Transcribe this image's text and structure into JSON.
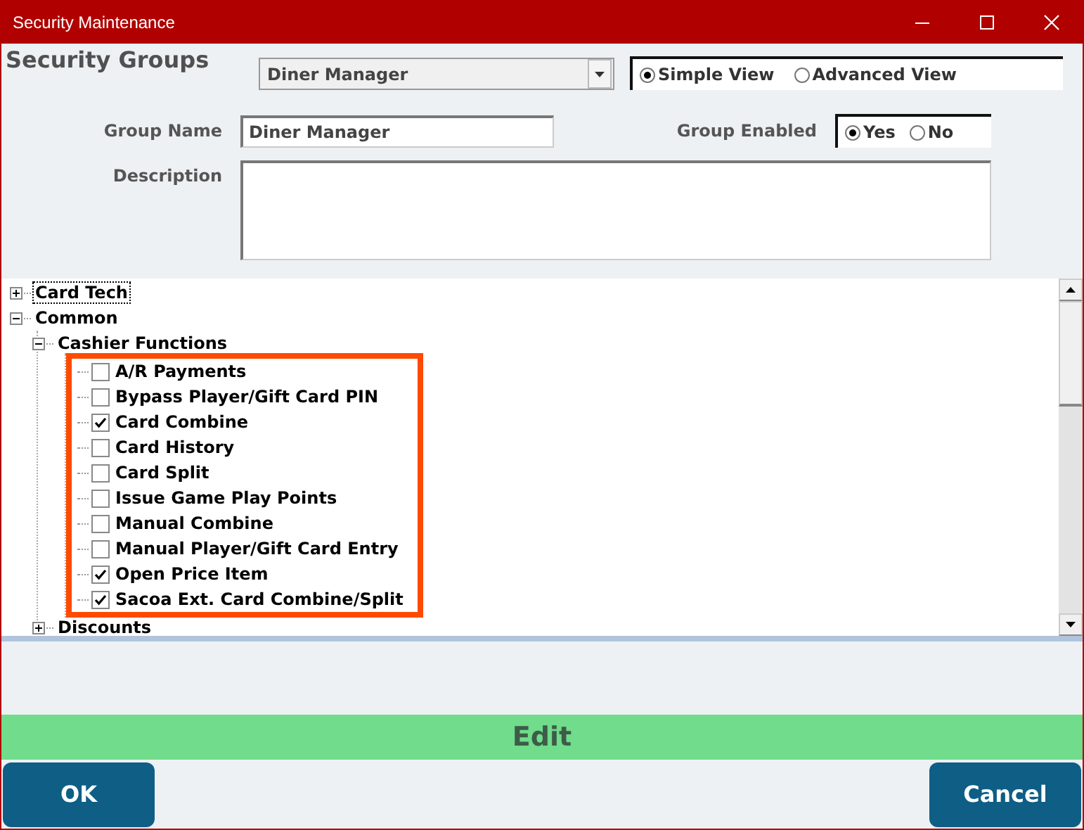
{
  "window": {
    "title": "Security Maintenance"
  },
  "header": {
    "title": "Security Groups",
    "group_select": {
      "value": "Diner Manager"
    },
    "view_options": [
      {
        "label": "Simple View",
        "selected": true
      },
      {
        "label": "Advanced View",
        "selected": false
      }
    ],
    "group_name": {
      "label": "Group Name",
      "value": "Diner Manager"
    },
    "group_enabled": {
      "label": "Group Enabled",
      "options": [
        {
          "label": "Yes",
          "selected": true
        },
        {
          "label": "No",
          "selected": false
        }
      ]
    },
    "description": {
      "label": "Description"
    }
  },
  "tree": [
    {
      "label": "Card Tech",
      "kind": "folder",
      "expanded": false,
      "focused": true
    },
    {
      "label": "Common",
      "kind": "folder",
      "expanded": true,
      "focused": false,
      "children": [
        {
          "label": "Cashier Functions",
          "kind": "folder",
          "expanded": true,
          "focused": false,
          "highlighted": true,
          "children": [
            {
              "label": "A/R Payments",
              "kind": "check",
              "checked": false
            },
            {
              "label": "Bypass Player/Gift Card PIN",
              "kind": "check",
              "checked": false
            },
            {
              "label": "Card Combine",
              "kind": "check",
              "checked": true
            },
            {
              "label": "Card History",
              "kind": "check",
              "checked": false
            },
            {
              "label": "Card Split",
              "kind": "check",
              "checked": false
            },
            {
              "label": "Issue Game Play Points",
              "kind": "check",
              "checked": false
            },
            {
              "label": "Manual Combine",
              "kind": "check",
              "checked": false
            },
            {
              "label": "Manual Player/Gift Card Entry",
              "kind": "check",
              "checked": false
            },
            {
              "label": "Open Price Item",
              "kind": "check",
              "checked": true
            },
            {
              "label": "Sacoa Ext. Card Combine/Split",
              "kind": "check",
              "checked": true
            }
          ]
        },
        {
          "label": "Discounts",
          "kind": "folder",
          "expanded": false,
          "focused": false
        }
      ]
    }
  ],
  "mode_bar": {
    "label": "Edit"
  },
  "buttons": [
    {
      "label": "OK"
    },
    {
      "label": "Cancel"
    }
  ]
}
